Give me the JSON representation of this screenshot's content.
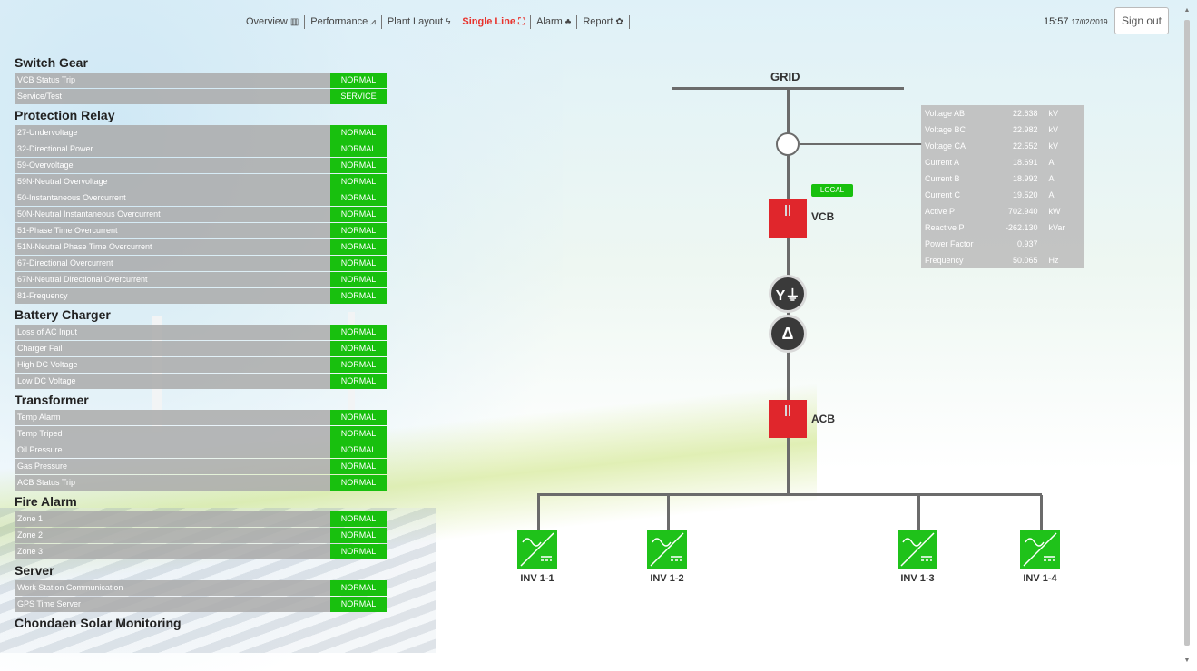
{
  "nav": {
    "items": [
      {
        "label": "Overview",
        "icon": "bar-chart-icon",
        "glyph": "▥"
      },
      {
        "label": "Performance",
        "icon": "line-chart-icon",
        "glyph": "⩘"
      },
      {
        "label": "Plant Layout",
        "icon": "bolt-icon",
        "glyph": "ϟ"
      },
      {
        "label": "Single Line",
        "icon": "single-line-icon",
        "glyph": "⛶"
      },
      {
        "label": "Alarm",
        "icon": "bell-icon",
        "glyph": "♣"
      },
      {
        "label": "Report",
        "icon": "palette-icon",
        "glyph": "✿"
      }
    ],
    "active": "Single Line",
    "active_color": "#e8322c"
  },
  "header": {
    "time": "15:57",
    "date": "17/02/2019",
    "sign_out_label": "Sign out"
  },
  "status_panel": {
    "normal_color": "#18c00e",
    "sections": [
      {
        "title": "Switch Gear",
        "rows": [
          {
            "label": "VCB Status Trip",
            "status": "NORMAL"
          },
          {
            "label": "Service/Test",
            "status": "SERVICE"
          }
        ]
      },
      {
        "title": "Protection Relay",
        "rows": [
          {
            "label": "27-Undervoltage",
            "status": "NORMAL"
          },
          {
            "label": "32-Directional Power",
            "status": "NORMAL"
          },
          {
            "label": "59-Overvoltage",
            "status": "NORMAL"
          },
          {
            "label": "59N-Neutral Overvoltage",
            "status": "NORMAL"
          },
          {
            "label": "50-Instantaneous Overcurrent",
            "status": "NORMAL"
          },
          {
            "label": "50N-Neutral Instantaneous Overcurrent",
            "status": "NORMAL"
          },
          {
            "label": "51-Phase Time Overcurrent",
            "status": "NORMAL"
          },
          {
            "label": "51N-Neutral Phase Time Overcurrent",
            "status": "NORMAL"
          },
          {
            "label": "67-Directional Overcurrent",
            "status": "NORMAL"
          },
          {
            "label": "67N-Neutral Directional Overcurrent",
            "status": "NORMAL"
          },
          {
            "label": "81-Frequency",
            "status": "NORMAL"
          }
        ]
      },
      {
        "title": "Battery Charger",
        "rows": [
          {
            "label": "Loss of AC Input",
            "status": "NORMAL"
          },
          {
            "label": "Charger Fail",
            "status": "NORMAL"
          },
          {
            "label": "High DC Voltage",
            "status": "NORMAL"
          },
          {
            "label": "Low DC Voltage",
            "status": "NORMAL"
          }
        ]
      },
      {
        "title": "Transformer",
        "rows": [
          {
            "label": "Temp Alarm",
            "status": "NORMAL"
          },
          {
            "label": "Temp Triped",
            "status": "NORMAL"
          },
          {
            "label": "Oil Pressure",
            "status": "NORMAL"
          },
          {
            "label": "Gas Pressure",
            "status": "NORMAL"
          },
          {
            "label": "ACB Status Trip",
            "status": "NORMAL"
          }
        ]
      },
      {
        "title": "Fire Alarm",
        "rows": [
          {
            "label": "Zone 1",
            "status": "NORMAL"
          },
          {
            "label": "Zone 2",
            "status": "NORMAL"
          },
          {
            "label": "Zone 3",
            "status": "NORMAL"
          }
        ]
      },
      {
        "title": "Server",
        "rows": [
          {
            "label": "Work Station Communication",
            "status": "NORMAL"
          },
          {
            "label": "GPS Time Server",
            "status": "NORMAL"
          }
        ]
      }
    ],
    "footer_title": "Chondaen Solar Monitoring"
  },
  "diagram": {
    "grid_label": "GRID",
    "vcb_label": "VCB",
    "acb_label": "ACB",
    "local_label": "LOCAL",
    "transformer_primary_symbol": "Y⏚",
    "transformer_secondary_symbol": "Δ",
    "breaker_color": "#e0262c",
    "inverter_color": "#1fc21a",
    "inverters": [
      "INV 1-1",
      "INV 1-2",
      "INV 1-3",
      "INV 1-4"
    ],
    "meter": [
      {
        "name": "Voltage AB",
        "value": "22.638",
        "unit": "kV"
      },
      {
        "name": "Voltage BC",
        "value": "22.982",
        "unit": "kV"
      },
      {
        "name": "Voltage CA",
        "value": "22.552",
        "unit": "kV"
      },
      {
        "name": "Current A",
        "value": "18.691",
        "unit": "A"
      },
      {
        "name": "Current B",
        "value": "18.992",
        "unit": "A"
      },
      {
        "name": "Current C",
        "value": "19.520",
        "unit": "A"
      },
      {
        "name": "Active P",
        "value": "702.940",
        "unit": "kW"
      },
      {
        "name": "Reactive P",
        "value": "-262.130",
        "unit": "kVar"
      },
      {
        "name": "Power Factor",
        "value": "0.937",
        "unit": ""
      },
      {
        "name": "Frequency",
        "value": "50.065",
        "unit": "Hz"
      }
    ]
  }
}
